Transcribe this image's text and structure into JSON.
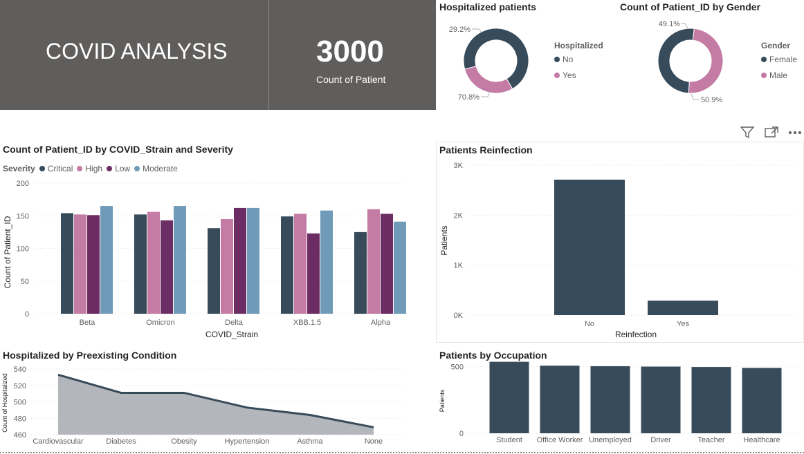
{
  "header": {
    "title": "COVID ANALYSIS",
    "kpi_value": "3000",
    "kpi_label": "Count of Patient"
  },
  "colors": {
    "dark": "#374b5a",
    "pink": "#c47ba4",
    "purple": "#6b2d63",
    "blue": "#6f9ab8",
    "banner": "#605e5c"
  },
  "toolbar_icons": [
    "filter-icon",
    "focus-mode-icon",
    "more-options-icon"
  ],
  "hospitalized_donut": {
    "title": "Hospitalized patients",
    "legend_title": "Hospitalized",
    "chart_data": {
      "type": "pie",
      "title": "Hospitalized patients",
      "legend_title": "Hospitalized",
      "slices": [
        {
          "label": "No",
          "value": 70.8,
          "display": "70.8%",
          "color": "#374b5a"
        },
        {
          "label": "Yes",
          "value": 29.2,
          "display": "29.2%",
          "color": "#c47ba4"
        }
      ]
    }
  },
  "gender_donut": {
    "title": "Count of Patient_ID by Gender",
    "legend_title": "Gender",
    "chart_data": {
      "type": "pie",
      "title": "Count of Patient_ID by Gender",
      "legend_title": "Gender",
      "slices": [
        {
          "label": "Female",
          "value": 50.9,
          "display": "50.9%",
          "color": "#374b5a"
        },
        {
          "label": "Male",
          "value": 49.1,
          "display": "49.1%",
          "color": "#c47ba4"
        }
      ]
    }
  },
  "strain_chart": {
    "title": "Count of Patient_ID by COVID_Strain and Severity",
    "legend_title": "Severity",
    "chart_data": {
      "type": "bar",
      "title": "Count of Patient_ID by COVID_Strain and Severity",
      "xlabel": "COVID_Strain",
      "ylabel": "Count of Patient_ID",
      "ylim": [
        0,
        200
      ],
      "yticks": [
        0,
        50,
        100,
        150,
        200
      ],
      "grid": true,
      "legend_position": "top-left",
      "categories": [
        "Beta",
        "Omicron",
        "Delta",
        "XBB.1.5",
        "Alpha"
      ],
      "series": [
        {
          "name": "Critical",
          "color": "#374b5a",
          "values": [
            154,
            152,
            131,
            149,
            125
          ]
        },
        {
          "name": "High",
          "color": "#c47ba4",
          "values": [
            152,
            156,
            145,
            153,
            160
          ]
        },
        {
          "name": "Low",
          "color": "#6b2d63",
          "values": [
            151,
            143,
            162,
            123,
            153
          ]
        },
        {
          "name": "Moderate",
          "color": "#6f9ab8",
          "values": [
            165,
            165,
            162,
            158,
            141
          ]
        }
      ]
    }
  },
  "reinfection_chart": {
    "title": "Patients Reinfection",
    "chart_data": {
      "type": "bar",
      "title": "Patients Reinfection",
      "xlabel": "Reinfection",
      "ylabel": "Patients",
      "ylim": [
        0,
        3000
      ],
      "yticks": [
        {
          "v": 0,
          "label": "0K"
        },
        {
          "v": 1000,
          "label": "1K"
        },
        {
          "v": 2000,
          "label": "2K"
        },
        {
          "v": 3000,
          "label": "3K"
        }
      ],
      "grid": true,
      "categories": [
        "No",
        "Yes"
      ],
      "values": [
        2710,
        290
      ],
      "color": "#374b5a"
    }
  },
  "preexisting_chart": {
    "title": "Hospitalized by Preexisting Condition",
    "chart_data": {
      "type": "area",
      "title": "Hospitalized by Preexisting Condition",
      "ylabel": "Count of Hospitalized",
      "xlabel": "",
      "ylim": [
        460,
        540
      ],
      "yticks": [
        460,
        480,
        500,
        520,
        540
      ],
      "grid": true,
      "categories": [
        "Cardiovascular",
        "Diabetes",
        "Obesity",
        "Hypertension",
        "Asthma",
        "None"
      ],
      "values": [
        533,
        511,
        511,
        493,
        484,
        469
      ]
    }
  },
  "occupation_chart": {
    "title": "Patients by Occupation",
    "chart_data": {
      "type": "bar",
      "title": "Patients by Occupation",
      "ylabel": "Patients",
      "xlabel": "",
      "ylim": [
        0,
        540
      ],
      "yticks": [
        0,
        500
      ],
      "grid": true,
      "categories": [
        "Student",
        "Office Worker",
        "Unemployed",
        "Driver",
        "Teacher",
        "Healthcare"
      ],
      "values": [
        537,
        508,
        504,
        501,
        498,
        491
      ],
      "color": "#374b5a"
    }
  }
}
